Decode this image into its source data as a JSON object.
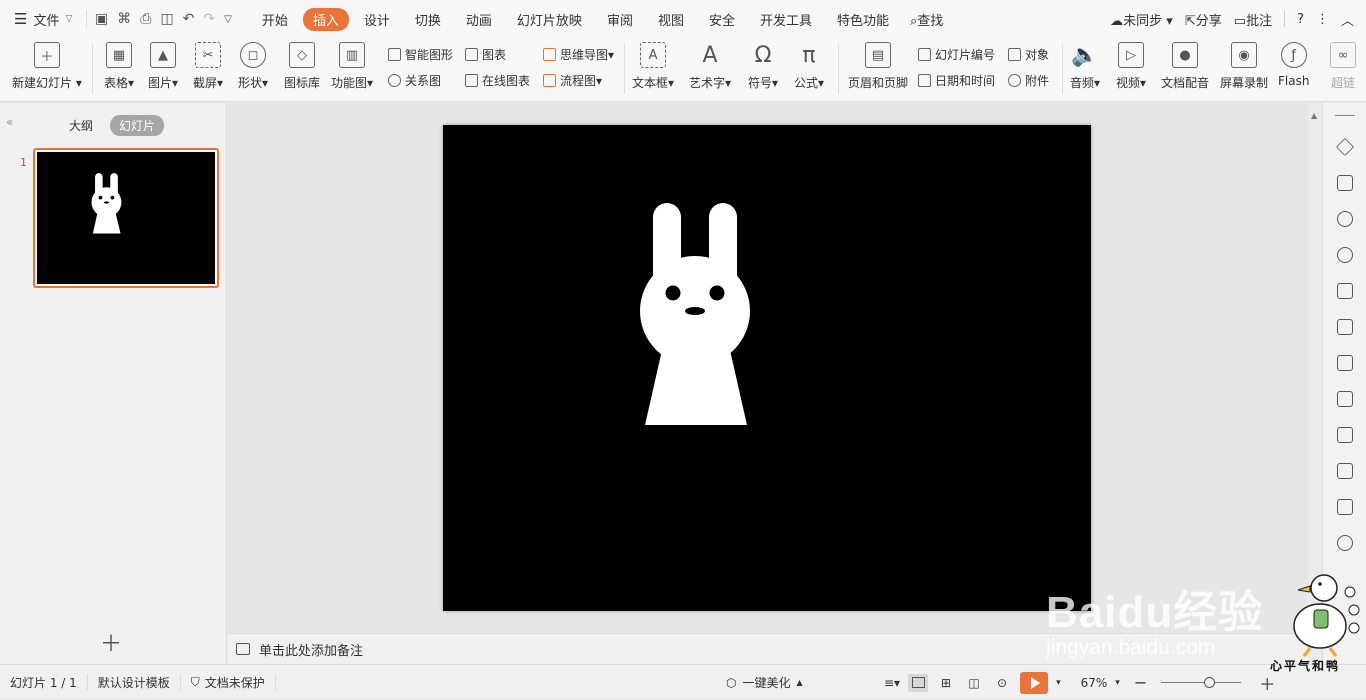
{
  "menubar": {
    "file_label": "文件",
    "tabs": [
      "开始",
      "插入",
      "设计",
      "切换",
      "动画",
      "幻灯片放映",
      "审阅",
      "视图",
      "安全",
      "开发工具",
      "特色功能"
    ],
    "active_tab": "插入",
    "search_label": "查找",
    "right": {
      "sync": "未同步",
      "share": "分享",
      "comment": "批注",
      "help": "?"
    }
  },
  "ribbon": {
    "new_slide": "新建幻灯片",
    "table": "表格",
    "picture": "图片",
    "screenshot": "截屏",
    "shape": "形状",
    "icon_lib": "图标库",
    "function_chart": "功能图",
    "smart_shape": "智能图形",
    "chart": "图表",
    "relation": "关系图",
    "online_chart": "在线图表",
    "mindmap": "思维导图",
    "flowchart": "流程图",
    "textbox": "文本框",
    "wordart": "艺术字",
    "symbol": "符号",
    "formula": "公式",
    "header_footer": "页眉和页脚",
    "slide_number": "幻灯片编号",
    "object": "对象",
    "datetime": "日期和时间",
    "attachment": "附件",
    "audio": "音频",
    "video": "视频",
    "doc_voice": "文档配音",
    "screen_record": "屏幕录制",
    "flash": "Flash",
    "hyperlink": "超链"
  },
  "left_panel": {
    "outline_tab": "大纲",
    "slides_tab": "幻灯片",
    "slide_number": "1"
  },
  "notes": {
    "placeholder": "单击此处添加备注"
  },
  "statusbar": {
    "slide_info": "幻灯片 1 / 1",
    "template": "默认设计模板",
    "protection": "文档未保护",
    "beautify": "一键美化",
    "zoom": "67%",
    "zoom_level": 0.6
  },
  "watermark": {
    "logo": "Baidu经验",
    "url": "jingyan.baidu.com",
    "tagline": "心平气和鸭"
  },
  "colors": {
    "accent": "#e8743b",
    "slide_bg": "#000000",
    "rabbit": "#ffffff"
  }
}
